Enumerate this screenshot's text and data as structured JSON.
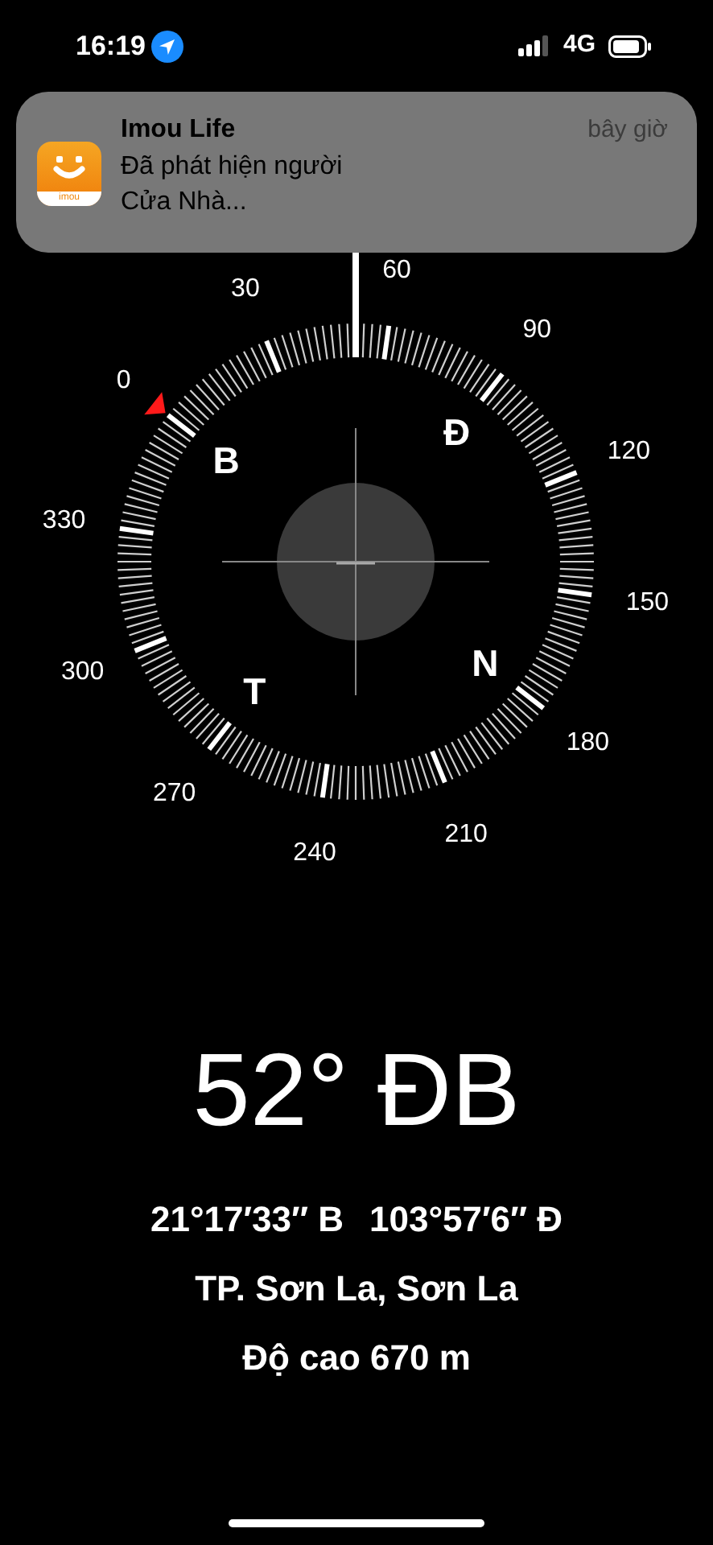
{
  "status_bar": {
    "time": "16:19",
    "network": "4G"
  },
  "notification": {
    "app": "Imou Life",
    "time": "bây giờ",
    "icon_text": "imou",
    "lines": [
      "Đã phát hiện người",
      "Cửa Nhà..."
    ]
  },
  "compass": {
    "degree_labels": [
      "0",
      "30",
      "60",
      "90",
      "120",
      "150",
      "180",
      "210",
      "240",
      "270",
      "300",
      "330"
    ],
    "directions": [
      "B",
      "Đ",
      "N",
      "T"
    ]
  },
  "heading": "52° ĐB",
  "coordinates": [
    "21°17′33″ B",
    "103°57′6″ Đ"
  ],
  "place": "TP. Sơn La, Sơn La",
  "altitude": "Độ cao 670 m"
}
